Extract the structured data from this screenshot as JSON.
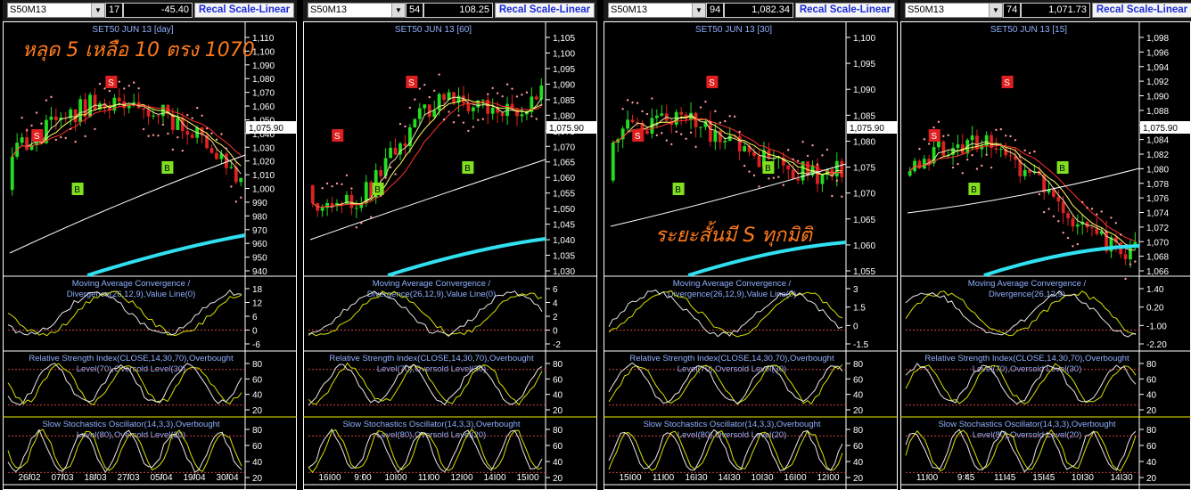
{
  "panels": [
    {
      "symbol": "S50M13",
      "num1": "17",
      "num2": "-45.40",
      "recal_label": "Recal Scale-Linear",
      "price_title": "SET50 JUN 13   [day]",
      "last_price": "1,075.90",
      "price_axis": [
        "1,110",
        "1,100",
        "1,090",
        "1,080",
        "1,070",
        "1,060",
        "1,050",
        "1,040",
        "1,030",
        "1,020",
        "1,010",
        "1,000",
        "990",
        "980",
        "970",
        "960",
        "950",
        "940"
      ],
      "macd_title": [
        "Moving Average Convergence /",
        "Divergence(26,12,9),Value Line(0)"
      ],
      "macd_axis": [
        "18",
        "12",
        "6",
        "0",
        "-6"
      ],
      "rsi_title": [
        "Relative Strength Index(CLOSE,14,30,70),Overbought",
        "Level(70),Oversold Level(30)"
      ],
      "rsi_axis": [
        "80",
        "60",
        "40",
        "20"
      ],
      "stoch_title": [
        "Slow Stochastics Oscillator(14,3,3),Overbought",
        "Level(80),Oversold Level(20)"
      ],
      "stoch_axis": [
        "80",
        "60",
        "40",
        "20"
      ],
      "x_axis": [
        "26/02",
        "07/03",
        "18/03",
        "27/03",
        "05/04",
        "19/04",
        "30/04"
      ],
      "annotation": "หลุด 5 เหลือ 10 ตรง 1070"
    },
    {
      "symbol": "S50M13",
      "num1": "54",
      "num2": "108.25",
      "recal_label": "Recal Scale-Linear",
      "price_title": "SET50 JUN 13   [60]",
      "last_price": "1,075.90",
      "price_axis": [
        "1,105",
        "1,100",
        "1,095",
        "1,090",
        "1,085",
        "1,080",
        "1,075",
        "1,070",
        "1,065",
        "1,060",
        "1,055",
        "1,050",
        "1,045",
        "1,040",
        "1,035",
        "1,030"
      ],
      "macd_title": [
        "Moving Average Convergence /",
        "Divergence(26,12,9),Value Line(0)"
      ],
      "macd_axis": [
        "6",
        "4",
        "2",
        "0",
        "-2"
      ],
      "rsi_title": [
        "Relative Strength Index(CLOSE,14,30,70),Overbought",
        "Level(70),Oversold Level(30)"
      ],
      "rsi_axis": [
        "80",
        "60",
        "40",
        "20"
      ],
      "stoch_title": [
        "Slow Stochastics Oscillator(14,3,3),Overbought",
        "Level(80),Oversold Level(20)"
      ],
      "stoch_axis": [
        "80",
        "60",
        "40",
        "20"
      ],
      "x_axis": [
        "16:00",
        "9:00",
        "10:00",
        "11:00",
        "12:00",
        "14:00",
        "15:00"
      ]
    },
    {
      "symbol": "S50M13",
      "num1": "94",
      "num2": "1,082.34",
      "recal_label": "Recal Scale-Linear",
      "price_title": "SET50 JUN 13   [30]",
      "last_price": "1,075.90",
      "price_axis": [
        "1,100",
        "1,095",
        "1,090",
        "1,085",
        "1,080",
        "1,075",
        "1,070",
        "1,065",
        "1,060",
        "1,055"
      ],
      "macd_title": [
        "Moving Average Convergence /",
        "Divergence(26,12,9),Value Line(0)"
      ],
      "macd_axis": [
        "3",
        "1.5",
        "0",
        "-1.5"
      ],
      "rsi_title": [
        "Relative Strength Index(CLOSE,14,30,70),Overbought",
        "Level(70),Oversold Level(30)"
      ],
      "rsi_axis": [
        "80",
        "60",
        "40",
        "20"
      ],
      "stoch_title": [
        "Slow Stochastics Oscillator(14,3,3),Overbought",
        "Level(80),Oversold Level(20)"
      ],
      "stoch_axis": [
        "80",
        "60",
        "40",
        "20"
      ],
      "x_axis": [
        "15:00",
        "11:00",
        "16:30",
        "14:30",
        "10:30",
        "16:00",
        "12:00"
      ],
      "annotation": "ระยะสั้นมี S ทุกมิติ"
    },
    {
      "symbol": "S50M13",
      "num1": "74",
      "num2": "1,071.73",
      "recal_label": "Recal Scale-Linear",
      "price_title": "SET50 JUN 13   [15]",
      "last_price": "1,075.90",
      "price_axis": [
        "1,098",
        "1,096",
        "1,094",
        "1,092",
        "1,090",
        "1,088",
        "1,086",
        "1,084",
        "1,082",
        "1,080",
        "1,078",
        "1,076",
        "1,074",
        "1,072",
        "1,070",
        "1,068",
        "1,066"
      ],
      "macd_title": [
        "Moving Average Convergence /",
        "Divergence(26,12,9)"
      ],
      "macd_axis": [
        "1.40",
        "0.20",
        "-1.00",
        "-2.20"
      ],
      "rsi_title": [
        "Relative Strength Index(CLOSE,14,30,70),Overbought",
        "Level(70),Oversold Level(30)"
      ],
      "rsi_axis": [
        "80",
        "60",
        "40",
        "20"
      ],
      "stoch_title": [
        "Slow Stochastics Oscillator(14,3,3),Overbought",
        "Level(80),Oversold Level(20)"
      ],
      "stoch_axis": [
        "80",
        "60",
        "40",
        "20"
      ],
      "x_axis": [
        "11:00",
        "9:45",
        "11:45",
        "15:45",
        "10:30",
        "14:30"
      ]
    }
  ]
}
